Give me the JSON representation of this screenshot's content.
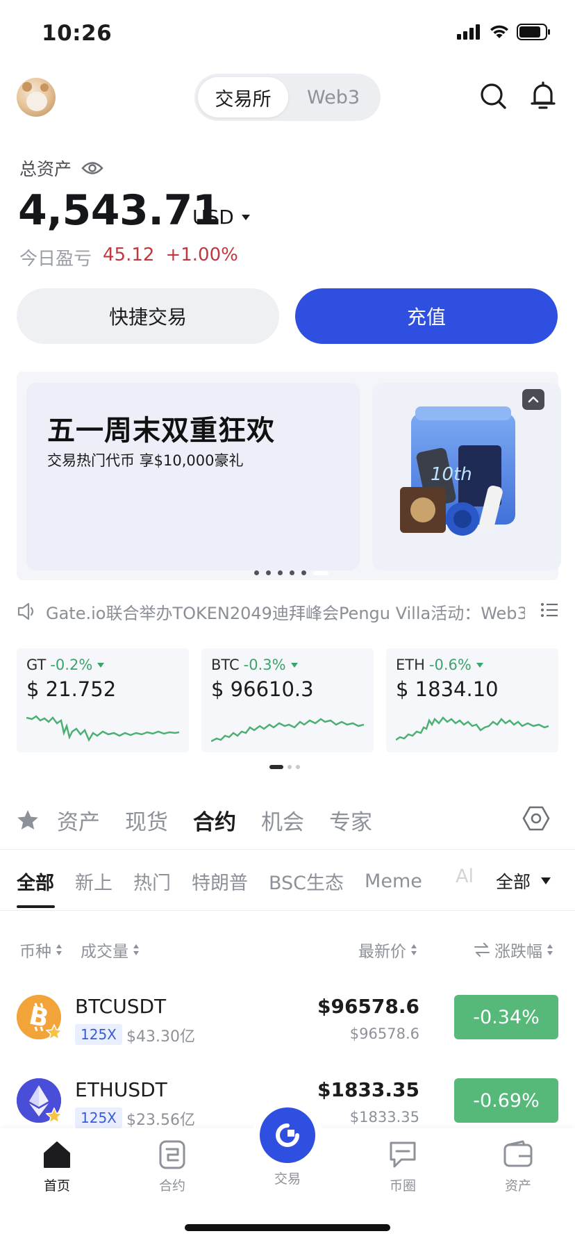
{
  "status_bar": {
    "time": "10:26"
  },
  "header": {
    "segments": [
      {
        "label": "交易所"
      },
      {
        "label": "Web3"
      }
    ],
    "icons": [
      "search-icon",
      "bell-icon"
    ]
  },
  "assets": {
    "label": "总资产",
    "total": "4,543.71",
    "currency": "USD",
    "pnl_label": "今日盈亏",
    "pnl_value": "45.12",
    "pnl_percent": "+1.00%"
  },
  "actions": {
    "quick_trade": "快捷交易",
    "deposit": "充值"
  },
  "banner": {
    "title": "五一周末双重狂欢",
    "subtitle": "交易热门代币 享$10,000豪礼",
    "slides": 6,
    "active_slide": 5
  },
  "notice": {
    "text": "Gate.io联合举办TOKEN2049迪拜峰会Pengu Villa活动：Web3..."
  },
  "tickers": [
    {
      "symbol": "GT",
      "change": "-0.2%",
      "price": "$ 21.752"
    },
    {
      "symbol": "BTC",
      "change": "-0.3%",
      "price": "$ 96610.3"
    },
    {
      "symbol": "ETH",
      "change": "-0.6%",
      "price": "$ 1834.10"
    }
  ],
  "main_tabs": [
    "资产",
    "现货",
    "合约",
    "机会",
    "专家"
  ],
  "main_tab_active": "合约",
  "sub_tabs": [
    "全部",
    "新上",
    "热门",
    "特朗普",
    "BSC生态",
    "Meme"
  ],
  "sub_tab_faded": "Al",
  "filter_dropdown": "全部",
  "columns": {
    "coin": "币种",
    "volume": "成交量",
    "price": "最新价",
    "change": "涨跌幅"
  },
  "rows": [
    {
      "pair": "BTCUSDT",
      "leverage": "125X",
      "volume": "$43.30亿",
      "price": "$96578.6",
      "price_sub": "$96578.6",
      "change": "-0.34%"
    },
    {
      "pair": "ETHUSDT",
      "leverage": "125X",
      "volume": "$23.56亿",
      "price": "$1833.35",
      "price_sub": "$1833.35",
      "change": "-0.69%"
    }
  ],
  "bottom_nav": [
    {
      "label": "首页",
      "icon": "home-icon"
    },
    {
      "label": "合约",
      "icon": "contract-icon"
    },
    {
      "label": "交易",
      "icon": "trade-icon"
    },
    {
      "label": "币圈",
      "icon": "chat-icon"
    },
    {
      "label": "资产",
      "icon": "wallet-icon"
    }
  ],
  "colors": {
    "brand_blue": "#2f4fe0",
    "up_red": "#c0383f",
    "down_green": "#3ba46a",
    "badge_green": "#56b97a"
  }
}
